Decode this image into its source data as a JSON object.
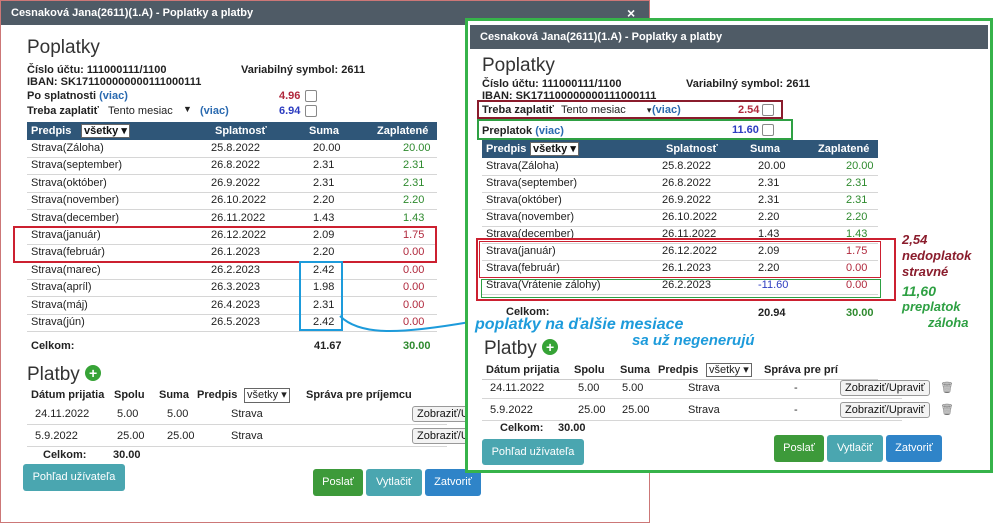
{
  "left": {
    "title": "Cesnaková Jana(2611)(1.A) - Poplatky a platby",
    "close_glyph": "×",
    "heading": "Poplatky",
    "account_label": "Číslo účtu: 111000111/1100",
    "iban_label": "IBAN: SK171100000000111000111",
    "varsym_label": "Variabilný symbol: 2611",
    "overdue_label": "Po splatnosti",
    "overdue_link": "(viac)",
    "overdue_value": "4.96",
    "topay_label": "Treba zaplatiť",
    "topay_select": "Tento mesiac",
    "topay_link": "(viac)",
    "topay_value": "6.94",
    "headers": [
      "Predpis",
      "Splatnosť",
      "Suma",
      "Zaplatené"
    ],
    "filter_select": "všetky",
    "rows": [
      [
        "Strava(Záloha)",
        "25.8.2022",
        "20.00",
        "20.00"
      ],
      [
        "Strava(september)",
        "26.8.2022",
        "2.31",
        "2.31"
      ],
      [
        "Strava(október)",
        "26.9.2022",
        "2.31",
        "2.31"
      ],
      [
        "Strava(november)",
        "26.10.2022",
        "2.20",
        "2.20"
      ],
      [
        "Strava(december)",
        "26.11.2022",
        "1.43",
        "1.43"
      ],
      [
        "Strava(január)",
        "26.12.2022",
        "2.09",
        "1.75"
      ],
      [
        "Strava(február)",
        "26.1.2023",
        "2.20",
        "0.00"
      ],
      [
        "Strava(marec)",
        "26.2.2023",
        "2.42",
        "0.00"
      ],
      [
        "Strava(apríl)",
        "26.3.2023",
        "1.98",
        "0.00"
      ],
      [
        "Strava(máj)",
        "26.4.2023",
        "2.31",
        "0.00"
      ],
      [
        "Strava(jún)",
        "26.5.2023",
        "2.42",
        "0.00"
      ]
    ],
    "total_label": "Celkom:",
    "total_sum": "41.67",
    "total_paid": "30.00",
    "payments_heading": "Platby",
    "payments_headers": [
      "Dátum prijatia",
      "Spolu",
      "Suma",
      "Predpis",
      "Správa pre príjemcu"
    ],
    "payments_filter": "všetky",
    "payments": [
      [
        "24.11.2022",
        "5.00",
        "5.00",
        "Strava",
        "Zobraziť/Upraviť"
      ],
      [
        "5.9.2022",
        "25.00",
        "25.00",
        "Strava",
        "Zobraziť/Upraviť"
      ]
    ],
    "payments_total_label": "Celkom:",
    "payments_total": "30.00",
    "user_view_button": "Pohľad užívateľa",
    "send_button": "Poslať",
    "print_button": "Vytlačiť",
    "close_button": "Zatvoriť"
  },
  "right": {
    "title": "Cesnaková Jana(2611)(1.A) - Poplatky a platby",
    "heading": "Poplatky",
    "account_label": "Číslo účtu: 111000111/1100",
    "iban_label": "IBAN: SK171100000000111000111",
    "varsym_label": "Variabilný symbol: 2611",
    "topay_label": "Treba zaplatiť",
    "topay_select": "Tento mesiac",
    "topay_link": "(viac)",
    "topay_value": "2.54",
    "overpay_label": "Preplatok",
    "overpay_link": "(viac)",
    "overpay_value": "11.60",
    "headers": [
      "Predpis",
      "Splatnosť",
      "Suma",
      "Zaplatené"
    ],
    "filter_select": "všetky",
    "rows": [
      [
        "Strava(Záloha)",
        "25.8.2022",
        "20.00",
        "20.00"
      ],
      [
        "Strava(september)",
        "26.8.2022",
        "2.31",
        "2.31"
      ],
      [
        "Strava(október)",
        "26.9.2022",
        "2.31",
        "2.31"
      ],
      [
        "Strava(november)",
        "26.10.2022",
        "2.20",
        "2.20"
      ],
      [
        "Strava(december)",
        "26.11.2022",
        "1.43",
        "1.43"
      ],
      [
        "Strava(január)",
        "26.12.2022",
        "2.09",
        "1.75"
      ],
      [
        "Strava(február)",
        "26.1.2023",
        "2.20",
        "0.00"
      ],
      [
        "Strava(Vrátenie zálohy)",
        "26.2.2023",
        "-11.60",
        "0.00"
      ]
    ],
    "total_label": "Celkom:",
    "total_sum": "20.94",
    "total_paid": "30.00",
    "payments_heading": "Platby",
    "payments_headers": [
      "Dátum prijatia",
      "Spolu",
      "Suma",
      "Predpis",
      "Správa pre prí"
    ],
    "payments_filter": "všetky",
    "payments": [
      [
        "24.11.2022",
        "5.00",
        "5.00",
        "Strava",
        "-",
        "Zobraziť/Upraviť"
      ],
      [
        "5.9.2022",
        "25.00",
        "25.00",
        "Strava",
        "-",
        "Zobraziť/Upraviť"
      ]
    ],
    "payments_total_label": "Celkom:",
    "payments_total": "30.00",
    "user_view_button": "Pohľad užívateľa",
    "send_button": "Poslať",
    "print_button": "Vytlačiť",
    "close_button": "Zatvoriť"
  },
  "annotations": {
    "underpay_lines": [
      "2,54",
      "nedoplatok",
      "stravné"
    ],
    "overpay_lines": [
      "11,60",
      "preplatok",
      "záloha"
    ],
    "next_months_line1": "poplatky na ďalšie mesiace",
    "next_months_line2": "sa už negenerujú"
  },
  "colors": {
    "titlebar": "#4f5b66",
    "table_header": "#2f5678",
    "annotation_red": "#cc2030",
    "annotation_green": "#2ea043",
    "annotation_blue": "#1d9bdb",
    "dark_red": "#8a1c2c"
  }
}
